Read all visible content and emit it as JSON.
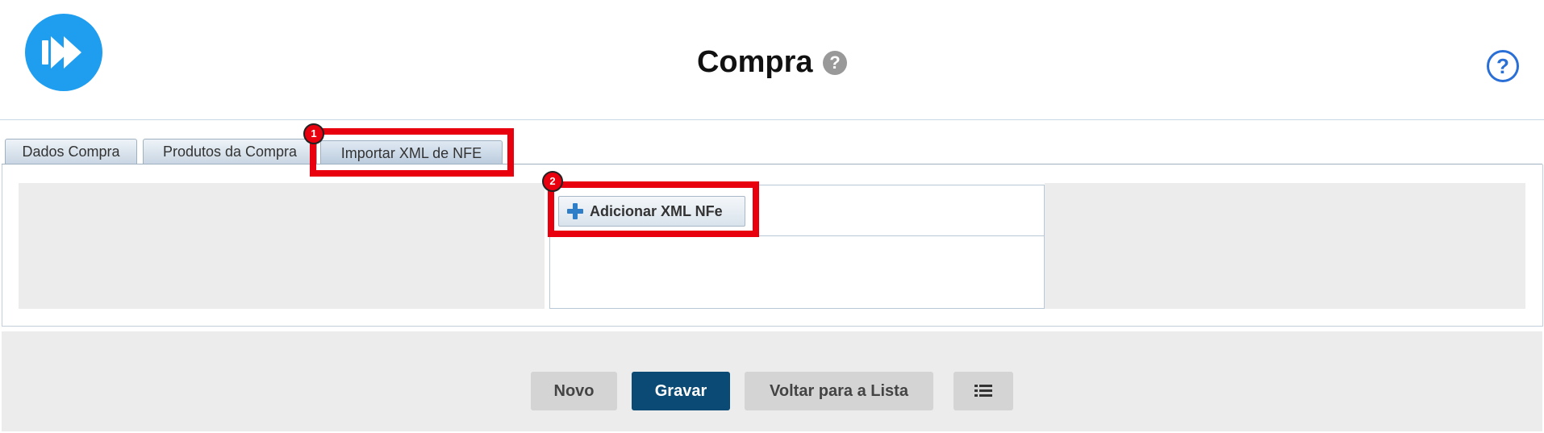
{
  "header": {
    "title": "Compra",
    "title_help_glyph": "?",
    "help_glyph": "?",
    "logo_icon": "fast-forward-logo",
    "accent_color": "#1f9ef0"
  },
  "tabs": [
    {
      "label": "Dados Compra",
      "active": false
    },
    {
      "label": "Produtos da Compra",
      "active": false
    },
    {
      "label": "Importar XML de NFE",
      "active": true
    }
  ],
  "import_panel": {
    "add_button_label": "Adicionar XML NFe",
    "add_icon": "plus-icon"
  },
  "annotations": [
    {
      "number": "1",
      "target": "Importar XML de NFE",
      "color": "#e8000f"
    },
    {
      "number": "2",
      "target": "Adicionar XML NFe",
      "color": "#e8000f"
    }
  ],
  "footer": {
    "new_label": "Novo",
    "save_label": "Gravar",
    "back_label": "Voltar para a Lista",
    "list_icon": "list-icon",
    "primary_color": "#0b4a74"
  }
}
